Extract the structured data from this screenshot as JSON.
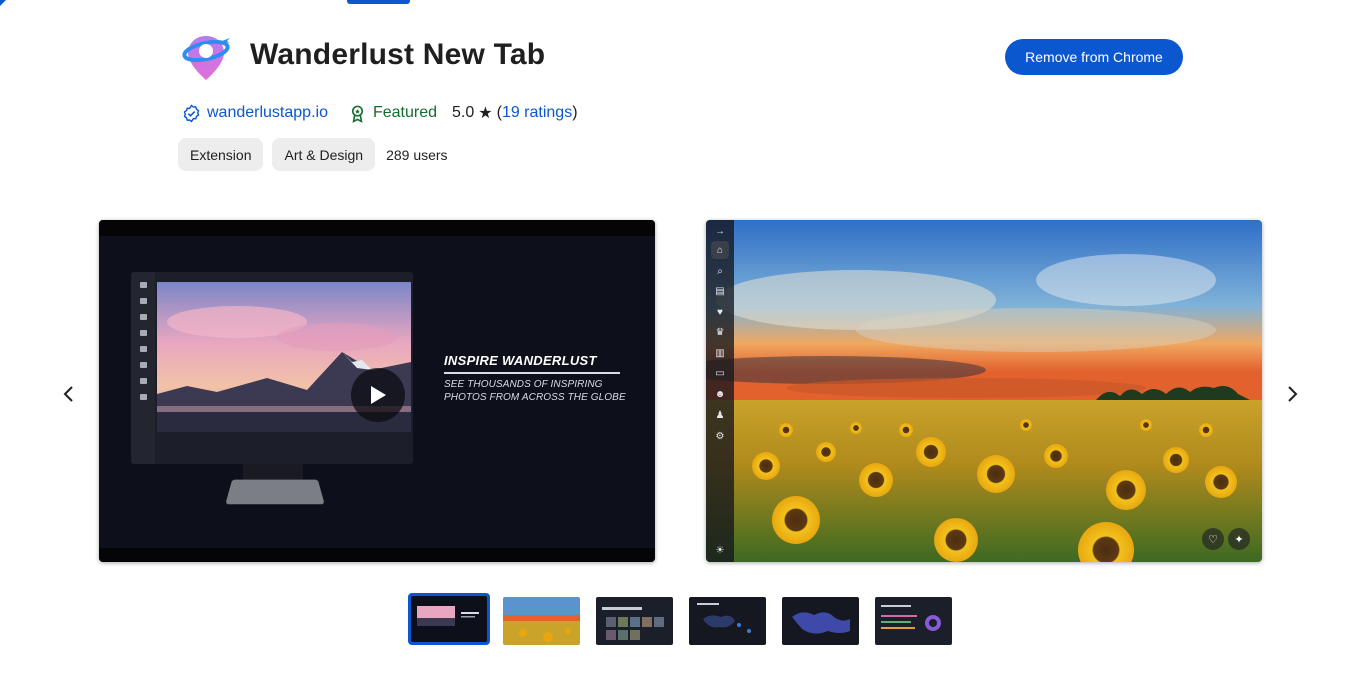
{
  "header": {
    "title": "Wanderlust New Tab",
    "remove_button": "Remove from Chrome"
  },
  "meta": {
    "website": "wanderlustapp.io",
    "featured": "Featured",
    "rating": "5.0",
    "star": "★",
    "ratings_open": "(",
    "ratings_link": "19 ratings",
    "ratings_close": ")"
  },
  "chips": {
    "type": "Extension",
    "category": "Art & Design",
    "users": "289 users"
  },
  "video_slide": {
    "headline": "INSPIRE WANDERLUST",
    "subtext": "SEE THOUSANDS OF INSPIRING PHOTOS FROM ACROSS THE GLOBE"
  },
  "icons": {
    "logo": "wanderlust-logo",
    "verified": "verified-badge-icon",
    "featured": "featured-award-icon",
    "prev": "chevron-left-icon",
    "next": "chevron-right-icon",
    "play": "play-icon"
  },
  "colors": {
    "accent": "#0b57d0",
    "featured": "#146c2e"
  },
  "thumbnails_count_visible": 6,
  "selected_thumbnail": 1
}
